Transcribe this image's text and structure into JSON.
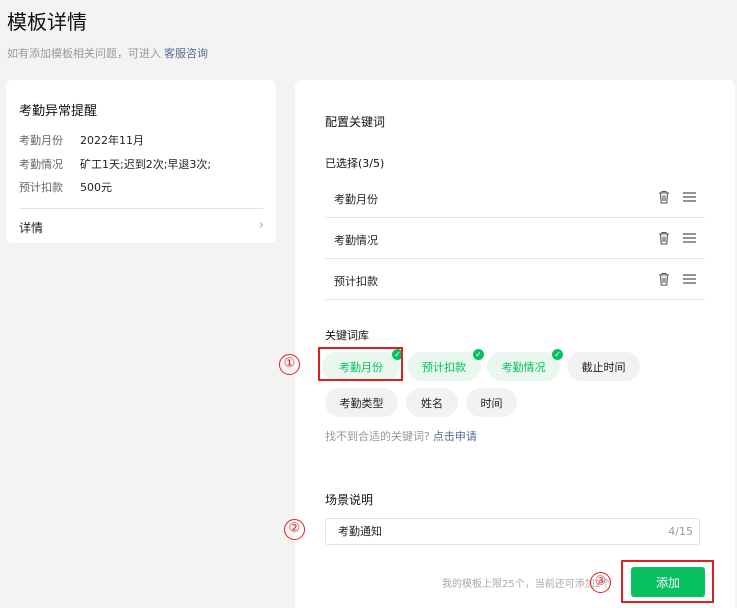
{
  "page": {
    "title": "模板详情",
    "hint_text": "如有添加模板相关问题，可进入",
    "hint_link": "客服咨询"
  },
  "summary": {
    "template_name": "考勤异常提醒",
    "fields": [
      {
        "key": "考勤月份",
        "value": "2022年11月"
      },
      {
        "key": "考勤情况",
        "value": "矿工1天;迟到2次;早退3次;"
      },
      {
        "key": "预计扣款",
        "value": "500元"
      }
    ],
    "detail_label": "详情",
    "chevron_icon": "chevron-right-icon"
  },
  "config": {
    "title": "配置关键词",
    "selected_label": "已选择(3/5)",
    "selected_items": [
      {
        "label": "考勤月份"
      },
      {
        "label": "考勤情况"
      },
      {
        "label": "预计扣款"
      }
    ],
    "library_label": "关键词库",
    "chips": [
      {
        "label": "考勤月份",
        "selected": true
      },
      {
        "label": "预计扣款",
        "selected": true
      },
      {
        "label": "考勤情况",
        "selected": true
      },
      {
        "label": "截止时间",
        "selected": false
      },
      {
        "label": "考勤类型",
        "selected": false
      },
      {
        "label": "姓名",
        "selected": false
      },
      {
        "label": "时间",
        "selected": false
      }
    ],
    "not_found_text": "找不到合适的关键词?",
    "not_found_link": "点击申请",
    "scene_label": "场景说明",
    "scene_value": "考勤通知",
    "scene_count": "4/15",
    "footer_note": "我的模板上限25个，当前还可添加2个",
    "add_label": "添加"
  },
  "annotations": [
    "①",
    "②",
    "③"
  ],
  "colors": {
    "accent": "#07c160",
    "chip_selected_bg": "#e9f7ee",
    "link": "#576b95",
    "annotation": "#e02020"
  }
}
